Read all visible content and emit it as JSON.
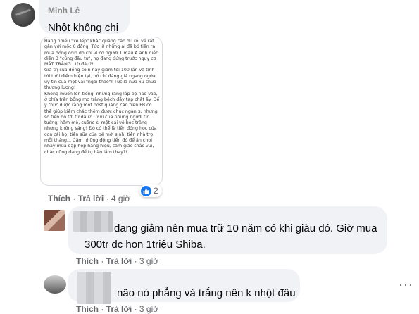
{
  "comment": {
    "author": "Minh Lê",
    "text": "Nhột không chị",
    "image_text": [
      "Hàng nhiều \"xe lếp\" khác quảng cáo đủ rồi về rất gần với mốc 0 đồng. Tức là những ai đã bỏ tiền ra mua đồng coin đó chỉ vì có người 1 mẩu A anh diễn điền B \"cũng đầu tư\", họ đang đứng trước nguy cơ MẤT TRẮNG...từ đâu?!",
      "Giá trị của đồng coin này giảm tới 100 lần và tính tới thời điểm hiện tại, nó chỉ đáng giá ngang ngửa uy tín của một vài \"ngôi thao\"! Tức là nửa xu chưa thương lượng!",
      "Không muốn lên tiếng, nhưng ráng lắp bộ não vào, ở phía trên bồng mơ trăng bệch đầy tạp chất ấy. Để ý thức được rằng một post quảng cáo trên FB có thể giúp kiếm chác thêm được chục ngàn $, nhưng số tiền đó tới từ đâu? Từ ví của những người tin tưởng, hâm mộ, cuồng si một cái vỏ bọc trắng nhưng không sáng! Đó có thể là tiền đóng học của con cái họ, tiền sữa của bé mới sinh, tiền nhà trọ mỗi tháng... Cầm những đồng tiền đó để ăn chơi nhảy múa đập hộp hàng hiệu, cảm giác chắc vui, chắc cũng đáng để tự hào lắm thay?!"
    ],
    "actions": {
      "like": "Thích",
      "reply": "Trả lời",
      "time": "4 giờ"
    },
    "reaction_count": "2"
  },
  "replies": [
    {
      "text_line1": "đang giảm nên mua trữ 10 năm có khi giàu đó. Giờ mua",
      "text_line2": "300tr dc hon 1triệu Shiba.",
      "actions": {
        "like": "Thích",
        "reply": "Trả lời",
        "time": "3 giờ"
      }
    },
    {
      "text": "não nó phẳng và trắng nên k nhột đâu",
      "actions": {
        "like": "Thích",
        "reply": "Trả lời",
        "time": "3 giờ"
      }
    }
  ],
  "colors": {
    "bubble": "#f0f2f5",
    "like_blue": "#1877f2",
    "meta_gray": "#65676b"
  },
  "icons": {
    "like": "like-icon",
    "more": "more-options-icon"
  }
}
